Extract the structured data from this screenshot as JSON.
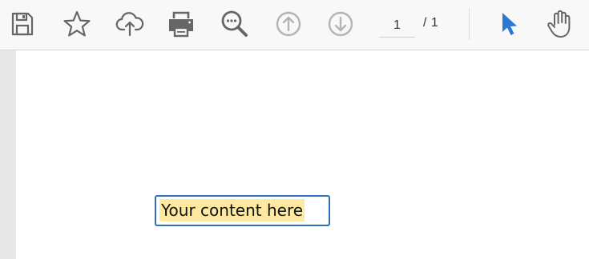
{
  "toolbar": {
    "buttons": [
      {
        "icon": "save-icon"
      },
      {
        "icon": "star-icon"
      },
      {
        "icon": "cloud-upload-icon"
      },
      {
        "icon": "print-icon"
      },
      {
        "icon": "search-zoom-icon"
      },
      {
        "icon": "arrow-up-circle-icon",
        "enabled": false
      },
      {
        "icon": "arrow-down-circle-icon",
        "enabled": false
      }
    ],
    "page_current": "1",
    "page_total": "/ 1",
    "select_tool_icon": "pointer-arrow-icon",
    "hand_tool_icon": "hand-icon"
  },
  "colors": {
    "icon_gray": "#666666",
    "icon_disabled": "#b4b4b4",
    "accent_blue": "#2d78d6",
    "field_border": "#2d6fbf",
    "field_highlight": "#fde9a0",
    "gutter": "#e8e8e8"
  },
  "document": {
    "text_field_value": "Your content here"
  }
}
